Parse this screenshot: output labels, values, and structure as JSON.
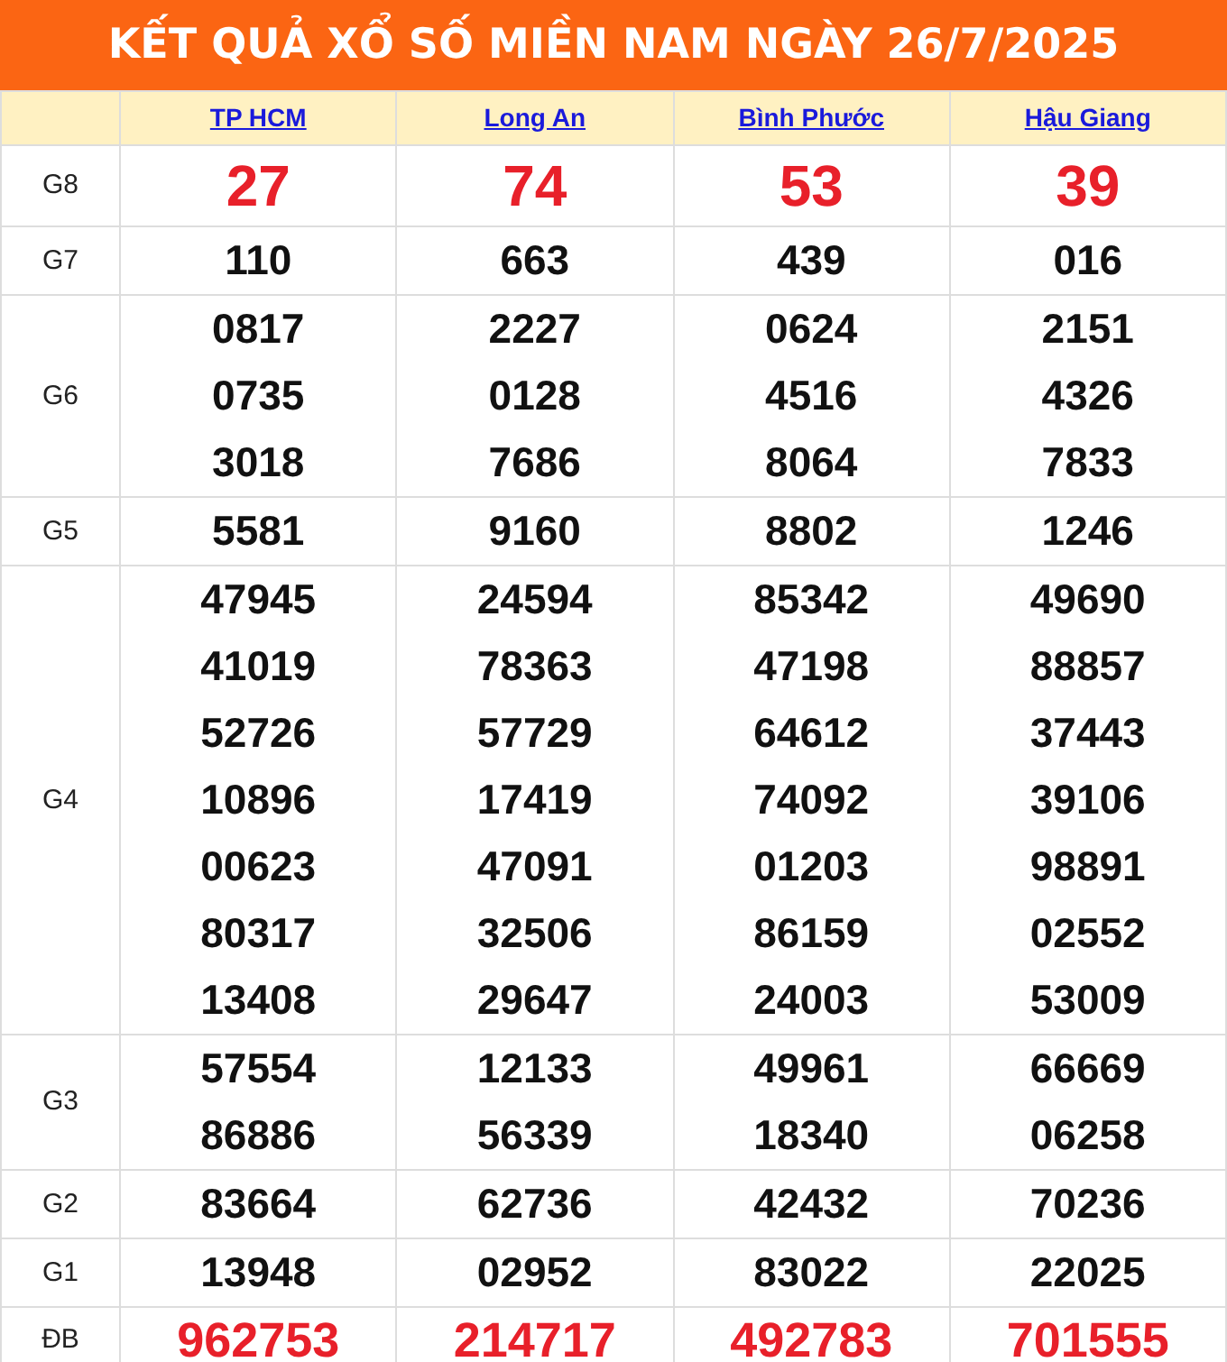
{
  "title": "KẾT QUẢ XỔ SỐ MIỀN NAM NGÀY 26/7/2025",
  "provinces": [
    "TP HCM",
    "Long An",
    "Bình Phước",
    "Hậu Giang"
  ],
  "prizes": [
    {
      "label": "G8",
      "kind": "large",
      "results": [
        [
          "27"
        ],
        [
          "74"
        ],
        [
          "53"
        ],
        [
          "39"
        ]
      ]
    },
    {
      "label": "G7",
      "kind": "normal",
      "results": [
        [
          "110"
        ],
        [
          "663"
        ],
        [
          "439"
        ],
        [
          "016"
        ]
      ]
    },
    {
      "label": "G6",
      "kind": "normal",
      "results": [
        [
          "0817",
          "0735",
          "3018"
        ],
        [
          "2227",
          "0128",
          "7686"
        ],
        [
          "0624",
          "4516",
          "8064"
        ],
        [
          "2151",
          "4326",
          "7833"
        ]
      ]
    },
    {
      "label": "G5",
      "kind": "normal",
      "results": [
        [
          "5581"
        ],
        [
          "9160"
        ],
        [
          "8802"
        ],
        [
          "1246"
        ]
      ]
    },
    {
      "label": "G4",
      "kind": "normal",
      "results": [
        [
          "47945",
          "41019",
          "52726",
          "10896",
          "00623",
          "80317",
          "13408"
        ],
        [
          "24594",
          "78363",
          "57729",
          "17419",
          "47091",
          "32506",
          "29647"
        ],
        [
          "85342",
          "47198",
          "64612",
          "74092",
          "01203",
          "86159",
          "24003"
        ],
        [
          "49690",
          "88857",
          "37443",
          "39106",
          "98891",
          "02552",
          "53009"
        ]
      ]
    },
    {
      "label": "G3",
      "kind": "normal",
      "results": [
        [
          "57554",
          "86886"
        ],
        [
          "12133",
          "56339"
        ],
        [
          "49961",
          "18340"
        ],
        [
          "66669",
          "06258"
        ]
      ]
    },
    {
      "label": "G2",
      "kind": "normal",
      "results": [
        [
          "83664"
        ],
        [
          "62736"
        ],
        [
          "42432"
        ],
        [
          "70236"
        ]
      ]
    },
    {
      "label": "G1",
      "kind": "normal",
      "results": [
        [
          "13948"
        ],
        [
          "02952"
        ],
        [
          "83022"
        ],
        [
          "22025"
        ]
      ]
    },
    {
      "label": "ĐB",
      "kind": "special",
      "results": [
        [
          "962753"
        ],
        [
          "214717"
        ],
        [
          "492783"
        ],
        [
          "701555"
        ]
      ]
    }
  ]
}
